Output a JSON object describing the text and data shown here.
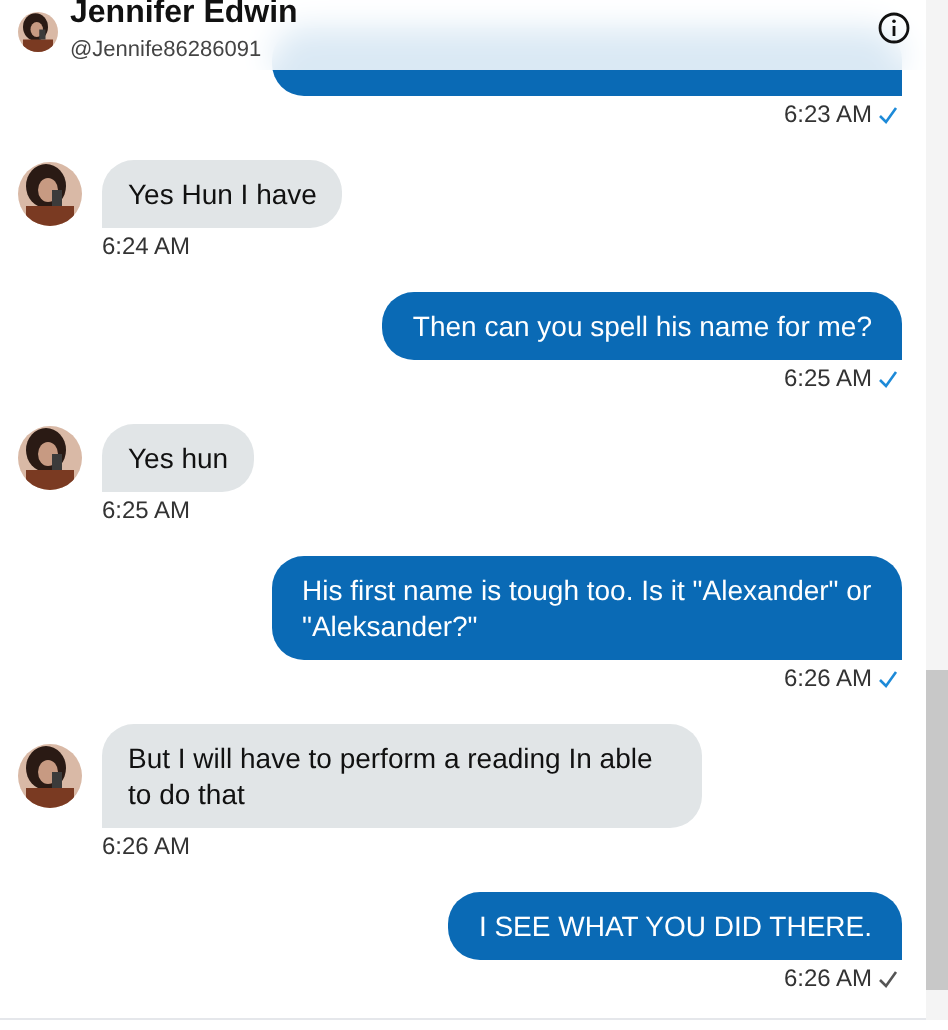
{
  "header": {
    "name": "Jennifer Edwin",
    "handle": "@Jennife86286091"
  },
  "messages": [
    {
      "kind": "sent",
      "time": "6:23 AM",
      "read": true
    },
    {
      "kind": "received",
      "text": "Yes Hun I have",
      "time": "6:24 AM"
    },
    {
      "kind": "sent",
      "text": "Then can you spell his name for me?",
      "time": "6:25 AM",
      "read": true
    },
    {
      "kind": "received",
      "text": "Yes hun",
      "time": "6:25 AM"
    },
    {
      "kind": "sent",
      "text": "His first name is tough too.  Is it \"Alexander\" or \"Aleksander?\"",
      "time": "6:26 AM",
      "read": true
    },
    {
      "kind": "received",
      "text": "But I will have to perform a reading In able to do that",
      "time": "6:26 AM"
    },
    {
      "kind": "sent",
      "text": "I SEE WHAT YOU DID THERE.",
      "time": "6:26 AM",
      "read": false
    }
  ]
}
